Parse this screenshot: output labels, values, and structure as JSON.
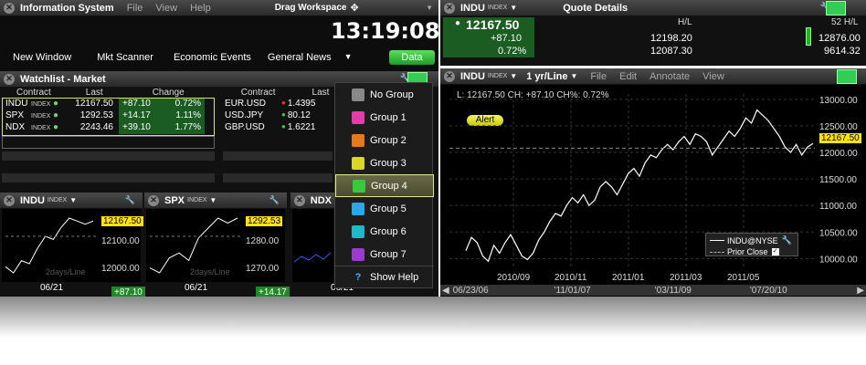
{
  "app": {
    "title": "Information System",
    "menu": [
      "File",
      "View",
      "Help"
    ],
    "drag_label": "Drag Workspace",
    "time": "13:19:08",
    "toolbar": [
      "New Window",
      "Mkt Scanner",
      "Economic Events",
      "General News"
    ],
    "data_button": "Data"
  },
  "watchlist": {
    "title": "Watchlist - Market",
    "headers_left": [
      "Contract",
      "Last",
      "Change"
    ],
    "headers_right": [
      "Contract",
      "Last"
    ],
    "rows": [
      {
        "sym": "INDU",
        "ex": "INDEX",
        "last": "12167.50",
        "chg": "+87.10",
        "pct": "0.72%"
      },
      {
        "sym": "SPX",
        "ex": "INDEX",
        "last": "1292.53",
        "chg": "+14.17",
        "pct": "1.11%"
      },
      {
        "sym": "NDX",
        "ex": "INDEX",
        "last": "2243.46",
        "chg": "+39.10",
        "pct": "1.77%"
      }
    ],
    "fx": [
      {
        "sym": "EUR.USD",
        "last": "1.4395"
      },
      {
        "sym": "USD.JPY",
        "last": "80.12"
      },
      {
        "sym": "GBP.USD",
        "last": "1.6221"
      }
    ]
  },
  "minis": [
    {
      "sym": "INDU",
      "ex": "INDEX",
      "price": "12167.50",
      "t1": "12200.00",
      "t2": "12100.00",
      "t3": "12000.00",
      "date": "06/21",
      "chg": "+87.10",
      "period": "2days/Line"
    },
    {
      "sym": "SPX",
      "ex": "INDEX",
      "price": "1292.53",
      "t1": "1290.00",
      "t2": "1280.00",
      "t3": "1270.00",
      "date": "06/21",
      "chg": "+14.17",
      "period": "2days/Line"
    },
    {
      "sym": "NDX",
      "ex": "",
      "date": "06/21"
    }
  ],
  "groups": {
    "items": [
      "No Group",
      "Group 1",
      "Group 2",
      "Group 3",
      "Group 4",
      "Group 5",
      "Group 6",
      "Group 7",
      "Show Help"
    ],
    "colors": [
      "#888888",
      "#e83aa8",
      "#e57a1a",
      "#d8d820",
      "#3cc83c",
      "#2aa7e8",
      "#1fb8c8",
      "#9a3ad0",
      "#2a6ae8"
    ],
    "selected": "Group 4"
  },
  "quote": {
    "title": "Quote Details",
    "sym": "INDU",
    "ex": "INDEX",
    "last": "12167.50",
    "chg": "+87.10",
    "pct": "0.72%",
    "hl_label": "H/L",
    "high": "12198.20",
    "low": "12087.30",
    "wk_label": "52 H/L",
    "wk_high": "12876.00",
    "wk_low": "9614.32"
  },
  "chart": {
    "sym": "INDU",
    "ex": "INDEX",
    "period": "1 yr/Line",
    "menu": [
      "File",
      "Edit",
      "Annotate",
      "View"
    ],
    "info": "L: 12167.50 CH: +87.10 CH%: 0.72%",
    "alert": "Alert",
    "price_tag": "12167.50",
    "legend_series": "INDU@NYSE",
    "legend_prior": "Prior Close",
    "scroll_labels": [
      "06/23/06",
      "'11/01/07",
      "'03/11/09",
      "'07/20/10"
    ]
  },
  "chart_data": {
    "type": "line",
    "title": "",
    "xlabel": "",
    "ylabel": "",
    "categories": [
      "2010/09",
      "2010/11",
      "2011/01",
      "2011/03",
      "2011/05"
    ],
    "y_ticks": [
      "13000.00",
      "12500.00",
      "12000.00",
      "11500.00",
      "11000.00",
      "10500.00",
      "10000.00"
    ],
    "ylim": [
      9800,
      13100
    ],
    "series": [
      {
        "name": "INDU@NYSE",
        "values": [
          10150,
          10400,
          10300,
          10050,
          9950,
          10250,
          10100,
          10300,
          10450,
          10250,
          10050,
          9980,
          10100,
          10350,
          10500,
          10700,
          10850,
          10800,
          11000,
          11150,
          11050,
          11200,
          11000,
          11100,
          11350,
          11450,
          11350,
          11200,
          11400,
          11600,
          11700,
          11550,
          11800,
          11950,
          11900,
          12050,
          12150,
          12050,
          12200,
          12300,
          12150,
          12350,
          12300,
          12200,
          11950,
          12100,
          12250,
          12400,
          12300,
          12450,
          12650,
          12550,
          12800,
          12700,
          12600,
          12450,
          12300,
          12100,
          12000,
          12150,
          11950,
          12100,
          12167
        ]
      }
    ],
    "grid": true,
    "legend": "bottom-right"
  }
}
